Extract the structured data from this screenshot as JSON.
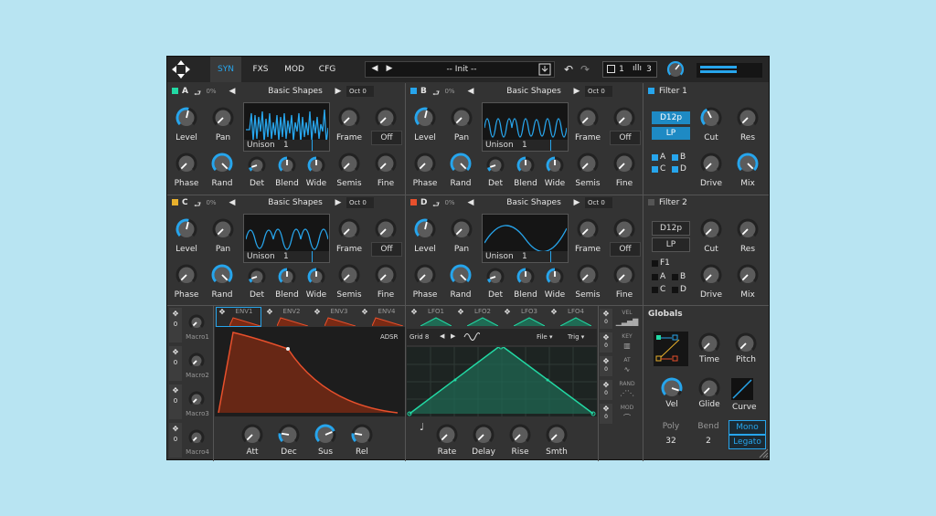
{
  "top": {
    "tabs": [
      "SYN",
      "FXS",
      "MOD",
      "CFG"
    ],
    "preset": "-- Init --",
    "voices": "1",
    "osc_count": "3"
  },
  "oscs": [
    {
      "name": "A",
      "pct": "0%",
      "wavetable": "Basic Shapes",
      "oct": "Oct",
      "oct_val": "0",
      "unison": "Unison",
      "unison_val": "1",
      "color": "#22d9a4",
      "frame_btn": "Off"
    },
    {
      "name": "B",
      "pct": "0%",
      "wavetable": "Basic Shapes",
      "oct": "Oct",
      "oct_val": "0",
      "unison": "Unison",
      "unison_val": "1",
      "color": "#27a5ec",
      "frame_btn": "Off"
    },
    {
      "name": "C",
      "pct": "0%",
      "wavetable": "Basic Shapes",
      "oct": "Oct",
      "oct_val": "0",
      "unison": "Unison",
      "unison_val": "1",
      "color": "#e8b02c",
      "frame_btn": "Off"
    },
    {
      "name": "D",
      "pct": "0%",
      "wavetable": "Basic Shapes",
      "oct": "Oct",
      "oct_val": "0",
      "unison": "Unison",
      "unison_val": "1",
      "color": "#e8502c",
      "frame_btn": "Off"
    }
  ],
  "osc_knobs": {
    "level": "Level",
    "pan": "Pan",
    "frame": "Frame",
    "phase": "Phase",
    "rand": "Rand",
    "det": "Det",
    "blend": "Blend",
    "wide": "Wide",
    "semis": "Semis",
    "fine": "Fine"
  },
  "filters": [
    {
      "title": "Filter 1",
      "type": "D12p",
      "mode": "LP",
      "cut": "Cut",
      "res": "Res",
      "drive": "Drive",
      "mix": "Mix",
      "routes": [
        "A",
        "B",
        "C",
        "D"
      ]
    },
    {
      "title": "Filter 2",
      "type": "D12p",
      "mode": "LP",
      "cut": "Cut",
      "res": "Res",
      "drive": "Drive",
      "mix": "Mix",
      "routes": [
        "F1",
        "A",
        "B",
        "C",
        "D"
      ]
    }
  ],
  "macros": [
    "Macro1",
    "Macro2",
    "Macro3",
    "Macro4"
  ],
  "mod_zero": "0",
  "env": {
    "tabs": [
      "ENV1",
      "ENV2",
      "ENV3",
      "ENV4"
    ],
    "mode": "ADSR",
    "knobs": [
      "Att",
      "Dec",
      "Sus",
      "Rel"
    ]
  },
  "lfo": {
    "tabs": [
      "LFO1",
      "LFO2",
      "LFO3",
      "LFO4"
    ],
    "grid": "Grid 8",
    "file": "File",
    "trig": "Trig",
    "knobs": [
      "Rate",
      "Delay",
      "Rise",
      "Smth"
    ]
  },
  "mod_sources": [
    "VEL",
    "KEY",
    "AT",
    "RAND",
    "MOD"
  ],
  "globals": {
    "title": "Globals",
    "time": "Time",
    "pitch": "Pitch",
    "vel": "Vel",
    "glide": "Glide",
    "curve": "Curve",
    "poly_label": "Poly",
    "poly_val": "32",
    "bend_label": "Bend",
    "bend_val": "2",
    "mono": "Mono",
    "legato": "Legato"
  },
  "colors": {
    "accent": "#27a5ec",
    "env": "#e8502c",
    "lfo": "#22d9a4"
  }
}
